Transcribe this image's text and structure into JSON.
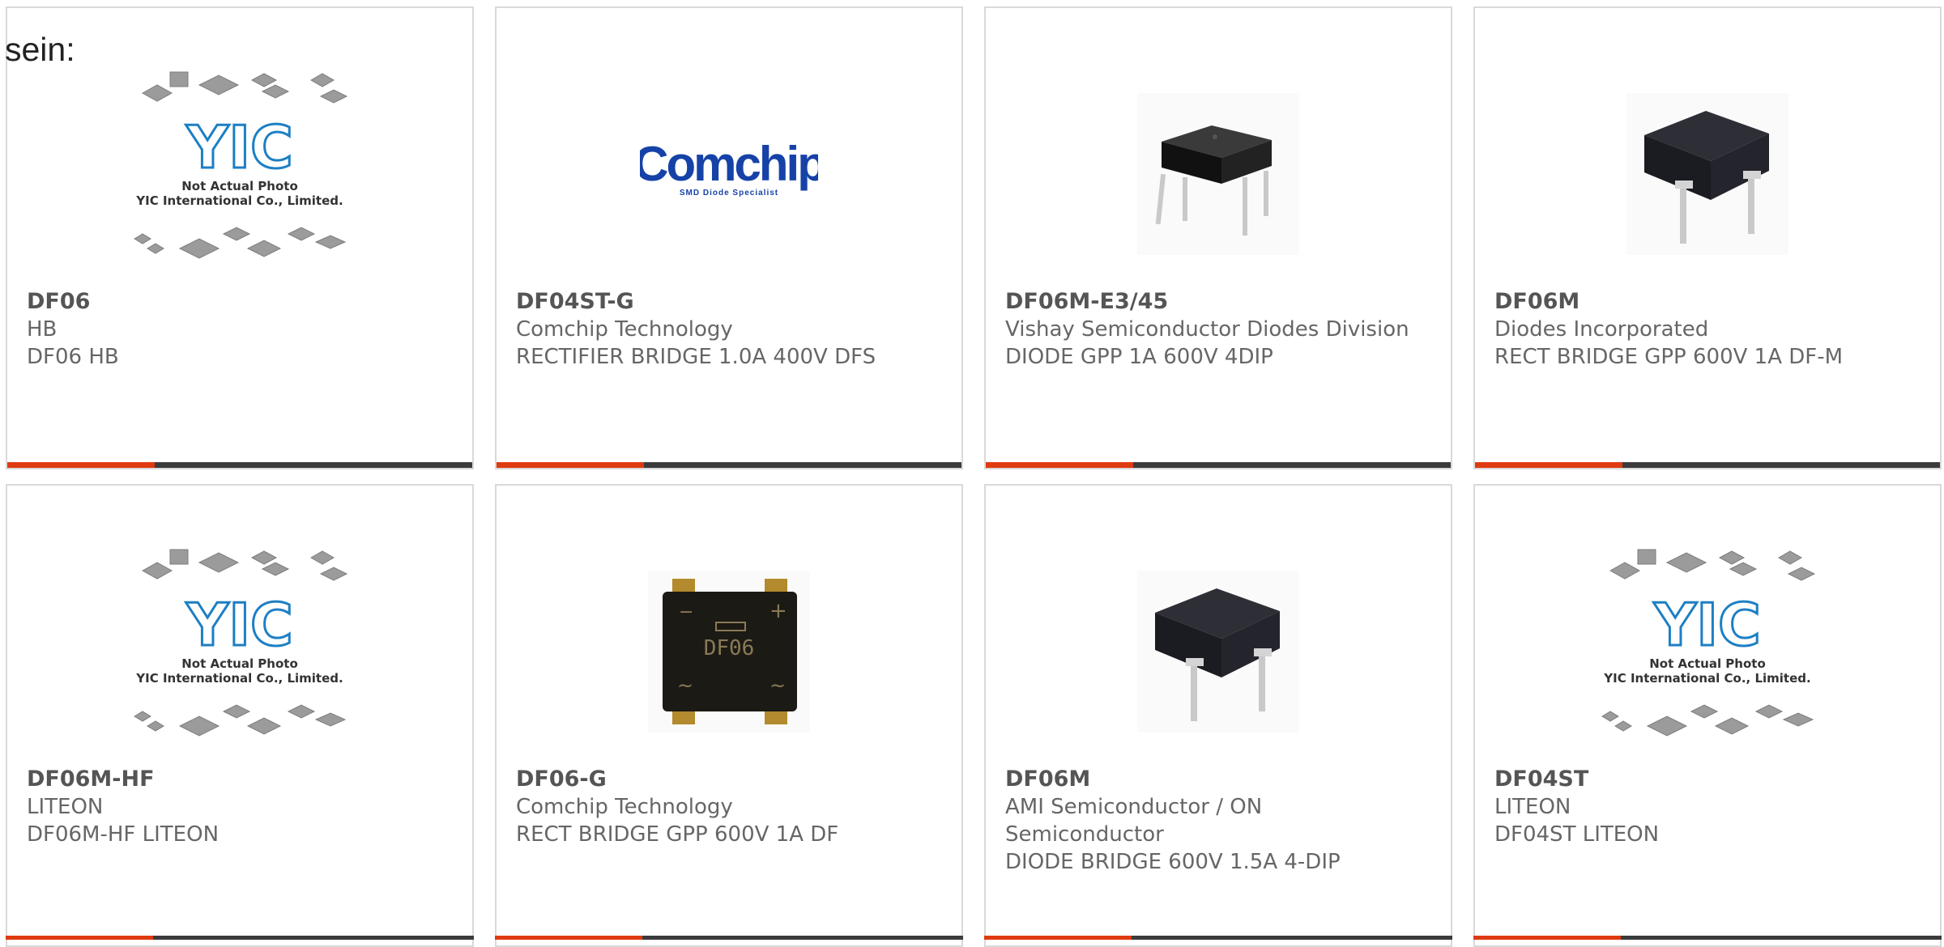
{
  "intro_text": "sein:",
  "placeholder_caption": [
    "Not Actual Photo",
    "YIC International Co., Limited."
  ],
  "placeholder_logo": "YIC",
  "comchip_logo": "Comchip",
  "comchip_tagline": "SMD Diode Specialist",
  "df06_chip_marking": "DF06",
  "colors": {
    "accent": "#e03a10",
    "bar_dark": "#3b3b3b",
    "yic_blue": "#1d7fc4",
    "comchip_blue": "#1642a8"
  },
  "products": [
    {
      "part": "DF06",
      "manufacturer": "HB",
      "description": "DF06 HB",
      "image": "yic-placeholder"
    },
    {
      "part": "DF04ST-G",
      "manufacturer": "Comchip Technology",
      "description": "RECTIFIER BRIDGE 1.0A 400V DFS",
      "image": "comchip-logo"
    },
    {
      "part": "DF06M-E3/45",
      "manufacturer": "Vishay Semiconductor Diodes Division",
      "description": "DIODE GPP 1A 600V 4DIP",
      "image": "dip-small"
    },
    {
      "part": "DF06M",
      "manufacturer": "Diodes Incorporated",
      "description": "RECT BRIDGE GPP 600V 1A DF-M",
      "image": "dip-large"
    },
    {
      "part": "DF06M-HF",
      "manufacturer": "LITEON",
      "description": "DF06M-HF LITEON",
      "image": "yic-placeholder"
    },
    {
      "part": "DF06-G",
      "manufacturer": "Comchip Technology",
      "description": "RECT BRIDGE GPP 600V 1A DF",
      "image": "df06-smd"
    },
    {
      "part": "DF06M",
      "manufacturer": "AMI Semiconductor / ON Semiconductor",
      "description": "DIODE BRIDGE 600V 1.5A 4-DIP",
      "image": "dip-large"
    },
    {
      "part": "DF04ST",
      "manufacturer": "LITEON",
      "description": "DF04ST LITEON",
      "image": "yic-placeholder"
    }
  ]
}
